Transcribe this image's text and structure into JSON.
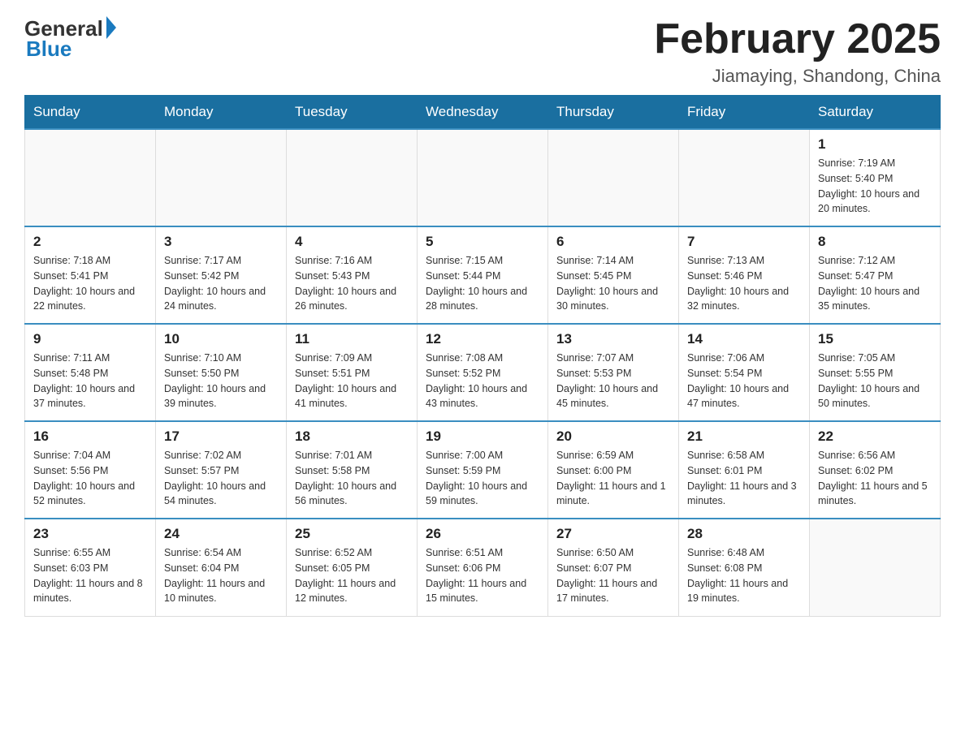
{
  "header": {
    "logo_general": "General",
    "logo_blue": "Blue",
    "month_title": "February 2025",
    "location": "Jiamaying, Shandong, China"
  },
  "weekdays": [
    "Sunday",
    "Monday",
    "Tuesday",
    "Wednesday",
    "Thursday",
    "Friday",
    "Saturday"
  ],
  "weeks": [
    {
      "days": [
        {
          "number": "",
          "info": ""
        },
        {
          "number": "",
          "info": ""
        },
        {
          "number": "",
          "info": ""
        },
        {
          "number": "",
          "info": ""
        },
        {
          "number": "",
          "info": ""
        },
        {
          "number": "",
          "info": ""
        },
        {
          "number": "1",
          "info": "Sunrise: 7:19 AM\nSunset: 5:40 PM\nDaylight: 10 hours and 20 minutes."
        }
      ]
    },
    {
      "days": [
        {
          "number": "2",
          "info": "Sunrise: 7:18 AM\nSunset: 5:41 PM\nDaylight: 10 hours and 22 minutes."
        },
        {
          "number": "3",
          "info": "Sunrise: 7:17 AM\nSunset: 5:42 PM\nDaylight: 10 hours and 24 minutes."
        },
        {
          "number": "4",
          "info": "Sunrise: 7:16 AM\nSunset: 5:43 PM\nDaylight: 10 hours and 26 minutes."
        },
        {
          "number": "5",
          "info": "Sunrise: 7:15 AM\nSunset: 5:44 PM\nDaylight: 10 hours and 28 minutes."
        },
        {
          "number": "6",
          "info": "Sunrise: 7:14 AM\nSunset: 5:45 PM\nDaylight: 10 hours and 30 minutes."
        },
        {
          "number": "7",
          "info": "Sunrise: 7:13 AM\nSunset: 5:46 PM\nDaylight: 10 hours and 32 minutes."
        },
        {
          "number": "8",
          "info": "Sunrise: 7:12 AM\nSunset: 5:47 PM\nDaylight: 10 hours and 35 minutes."
        }
      ]
    },
    {
      "days": [
        {
          "number": "9",
          "info": "Sunrise: 7:11 AM\nSunset: 5:48 PM\nDaylight: 10 hours and 37 minutes."
        },
        {
          "number": "10",
          "info": "Sunrise: 7:10 AM\nSunset: 5:50 PM\nDaylight: 10 hours and 39 minutes."
        },
        {
          "number": "11",
          "info": "Sunrise: 7:09 AM\nSunset: 5:51 PM\nDaylight: 10 hours and 41 minutes."
        },
        {
          "number": "12",
          "info": "Sunrise: 7:08 AM\nSunset: 5:52 PM\nDaylight: 10 hours and 43 minutes."
        },
        {
          "number": "13",
          "info": "Sunrise: 7:07 AM\nSunset: 5:53 PM\nDaylight: 10 hours and 45 minutes."
        },
        {
          "number": "14",
          "info": "Sunrise: 7:06 AM\nSunset: 5:54 PM\nDaylight: 10 hours and 47 minutes."
        },
        {
          "number": "15",
          "info": "Sunrise: 7:05 AM\nSunset: 5:55 PM\nDaylight: 10 hours and 50 minutes."
        }
      ]
    },
    {
      "days": [
        {
          "number": "16",
          "info": "Sunrise: 7:04 AM\nSunset: 5:56 PM\nDaylight: 10 hours and 52 minutes."
        },
        {
          "number": "17",
          "info": "Sunrise: 7:02 AM\nSunset: 5:57 PM\nDaylight: 10 hours and 54 minutes."
        },
        {
          "number": "18",
          "info": "Sunrise: 7:01 AM\nSunset: 5:58 PM\nDaylight: 10 hours and 56 minutes."
        },
        {
          "number": "19",
          "info": "Sunrise: 7:00 AM\nSunset: 5:59 PM\nDaylight: 10 hours and 59 minutes."
        },
        {
          "number": "20",
          "info": "Sunrise: 6:59 AM\nSunset: 6:00 PM\nDaylight: 11 hours and 1 minute."
        },
        {
          "number": "21",
          "info": "Sunrise: 6:58 AM\nSunset: 6:01 PM\nDaylight: 11 hours and 3 minutes."
        },
        {
          "number": "22",
          "info": "Sunrise: 6:56 AM\nSunset: 6:02 PM\nDaylight: 11 hours and 5 minutes."
        }
      ]
    },
    {
      "days": [
        {
          "number": "23",
          "info": "Sunrise: 6:55 AM\nSunset: 6:03 PM\nDaylight: 11 hours and 8 minutes."
        },
        {
          "number": "24",
          "info": "Sunrise: 6:54 AM\nSunset: 6:04 PM\nDaylight: 11 hours and 10 minutes."
        },
        {
          "number": "25",
          "info": "Sunrise: 6:52 AM\nSunset: 6:05 PM\nDaylight: 11 hours and 12 minutes."
        },
        {
          "number": "26",
          "info": "Sunrise: 6:51 AM\nSunset: 6:06 PM\nDaylight: 11 hours and 15 minutes."
        },
        {
          "number": "27",
          "info": "Sunrise: 6:50 AM\nSunset: 6:07 PM\nDaylight: 11 hours and 17 minutes."
        },
        {
          "number": "28",
          "info": "Sunrise: 6:48 AM\nSunset: 6:08 PM\nDaylight: 11 hours and 19 minutes."
        },
        {
          "number": "",
          "info": ""
        }
      ]
    }
  ]
}
